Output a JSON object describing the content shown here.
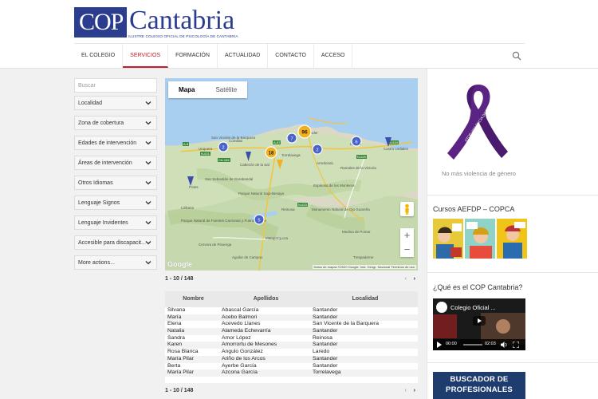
{
  "logo": {
    "mark": "COP",
    "word": "Cantabria",
    "subtitle": "ILUSTRE COLEGIO OFICIAL DE PSICOLOGÍA DE CANTABRIA"
  },
  "nav": {
    "items": [
      {
        "label": "EL COLEGIO",
        "active": false
      },
      {
        "label": "SERVICIOS",
        "active": true
      },
      {
        "label": "FORMACIÓN",
        "active": false
      },
      {
        "label": "ACTUALIDAD",
        "active": false
      },
      {
        "label": "CONTACTO",
        "active": false
      },
      {
        "label": "ACCESO",
        "active": false
      }
    ],
    "search_icon": "search-icon"
  },
  "filters": {
    "search_placeholder": "Buscar",
    "items": [
      "Localidad",
      "Zona de cobertura",
      "Edades de intervención",
      "Áreas de intervención",
      "Otros Idiomas",
      "Lenguaje Signos",
      "Lenguaje Invidentes",
      "Accesible para discapacit...",
      "More actions..."
    ]
  },
  "map": {
    "tabs": [
      "Mapa",
      "Satélite"
    ],
    "active_tab": "Mapa",
    "clusters": [
      "96",
      "18",
      "7",
      "2",
      "2",
      "6",
      "5"
    ],
    "labels": {
      "santander": "Santander",
      "torrelavega": "Torrelavega",
      "comillas": "Comillas",
      "unquera": "Unquera",
      "san_vicente": "San Vicente de la Barquera",
      "castro": "Castro Urdiales",
      "laredo": "Laredo",
      "ramales": "Ramales de la Victoria",
      "parque_saja": "Parque Natural Saja-Besaya",
      "reinosa": "Reinosa",
      "potes": "Potes",
      "mataporquera": "Mataporquera",
      "aguilar": "Aguilar de Campoo",
      "medina": "Medina de Pomar",
      "cervera": "Cervera de Pisuerga",
      "ojo_guarena": "Monumento Natural de Ojo Guareña",
      "trespaderne": "Trespaderne",
      "espinosa": "Espinosa de los Monteros",
      "arredondo": "Arredondo",
      "liebana": "Liébana",
      "fuentes": "Parque Natural de Fuentes Carrionas y Fuente Cobre",
      "cabezon": "Cabezón de la Sal",
      "san_sebastian": "San Sebastián de Garabandal",
      "roads": [
        "N-634",
        "A-67",
        "A-8",
        "N-623",
        "CA-184",
        "N-629",
        "N-621"
      ]
    },
    "google_logo": "Google",
    "attribution": "Datos de mapas ©2020 Google, Inst. Geogr. Nacional   Términos de uso",
    "zoom_in": "+",
    "zoom_out": "−"
  },
  "pager": {
    "range": "1 - 10 / 148",
    "prev": "‹",
    "next": "›"
  },
  "table": {
    "columns": [
      "Nombre",
      "Apellidos",
      "Localidad"
    ],
    "rows": [
      [
        "Silvana",
        "Abascal García",
        "Santander"
      ],
      [
        "María",
        "Acebo Balmori",
        "Santander"
      ],
      [
        "Elena",
        "Acevedo Llanes",
        "San Vicente de la Barquera"
      ],
      [
        "Natalia",
        "Alameda Echevarría",
        "Santander"
      ],
      [
        "Sandra",
        "Amor López",
        "Reinosa"
      ],
      [
        "Karen",
        "Amorrortu de Mesones",
        "Santander"
      ],
      [
        "Rosa Blanca",
        "Angulo González",
        "Laredo"
      ],
      [
        "María Pilar",
        "Ariño de los Arcos",
        "Santander"
      ],
      [
        "Berta",
        "Ayerbe García",
        "Santander"
      ],
      [
        "María Pilar",
        "Azcona García",
        "Torrelavega"
      ]
    ]
  },
  "sidebar": {
    "ribbon_caption": "No más violencia de género",
    "ribbon_text": "STOP VIOLENCIA DE GÉNERO",
    "cursos_title": "Cursos AEFDP – COPCA",
    "que_es_title": "¿Qué es el COP Cantabria?",
    "video": {
      "title": "Colegio Oficial ...",
      "time_current": "00:00",
      "time_total": "02:03"
    },
    "banner": "BUSCADOR DE PROFESIONALES"
  },
  "colors": {
    "brand_blue": "#2b3d8f",
    "active_red": "#c0202c",
    "ribbon_purple": "#4a1a6e",
    "marker_blue": "#4a63c9",
    "marker_yellow": "#f2b01e"
  }
}
